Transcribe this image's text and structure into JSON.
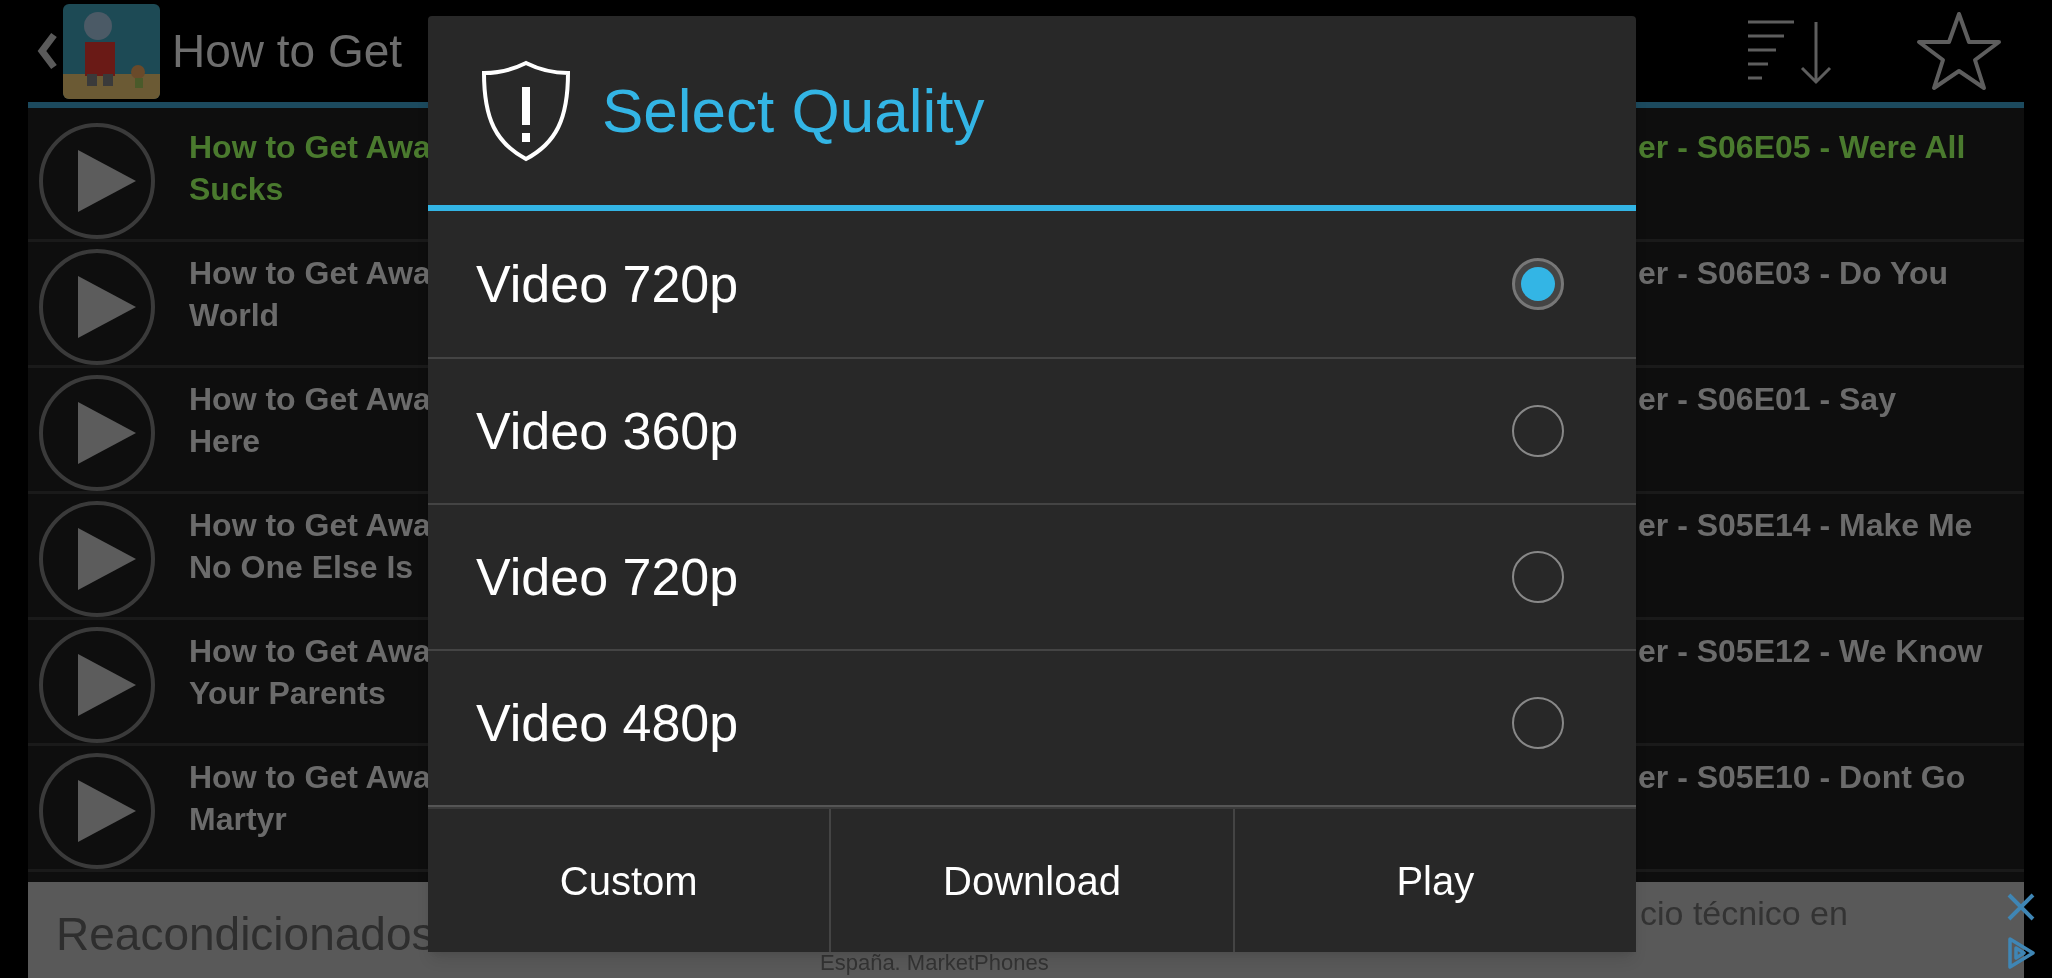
{
  "header": {
    "title": "How to Get"
  },
  "episodes": [
    {
      "title_start": [
        "How to Get Awa",
        "Sucks"
      ],
      "title_end": "er - S06E05 - Were All",
      "selected": true
    },
    {
      "title_start": [
        "How to Get Awa",
        "World"
      ],
      "title_end": "er - S06E03 - Do You",
      "selected": false
    },
    {
      "title_start": [
        "How to Get Awa",
        "Here"
      ],
      "title_end": "er - S06E01 - Say",
      "selected": false
    },
    {
      "title_start": [
        "How to Get Awa",
        "No One Else Is"
      ],
      "title_end": "er - S05E14 - Make Me",
      "selected": false
    },
    {
      "title_start": [
        "How to Get Awa",
        "Your Parents"
      ],
      "title_end": "er - S05E12 - We Know",
      "selected": false
    },
    {
      "title_start": [
        "How to Get Awa",
        "Martyr"
      ],
      "title_end": "er - S05E10 - Dont Go",
      "selected": false
    }
  ],
  "ad": {
    "headline": "Reacondicionados",
    "text_right": "cio técnico en",
    "text_below": "España. MarketPhones"
  },
  "dialog": {
    "title": "Select Quality",
    "options": [
      {
        "label": "Video 720p",
        "selected": true
      },
      {
        "label": "Video 360p",
        "selected": false
      },
      {
        "label": "Video 720p",
        "selected": false
      },
      {
        "label": "Video 480p",
        "selected": false
      }
    ],
    "buttons": [
      "Custom",
      "Download",
      "Play"
    ]
  }
}
